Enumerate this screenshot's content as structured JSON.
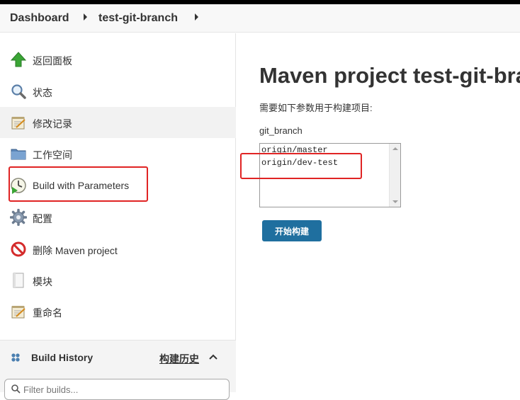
{
  "breadcrumb": {
    "items": [
      "Dashboard",
      "test-git-branch"
    ]
  },
  "sidebar": {
    "items": [
      {
        "label": "返回面板",
        "icon": "up-arrow-icon"
      },
      {
        "label": "状态",
        "icon": "magnifier-icon"
      },
      {
        "label": "修改记录",
        "icon": "notepad-icon"
      },
      {
        "label": "工作空间",
        "icon": "folder-icon"
      },
      {
        "label": "Build with Parameters",
        "icon": "clock-icon"
      },
      {
        "label": "配置",
        "icon": "gear-icon"
      },
      {
        "label": "删除 Maven project",
        "icon": "no-entry-icon"
      },
      {
        "label": "模块",
        "icon": "document-icon"
      },
      {
        "label": "重命名",
        "icon": "notepad-icon"
      }
    ]
  },
  "build_history": {
    "title": "Build History",
    "trend_link": "构建历史",
    "filter_placeholder": "Filter builds..."
  },
  "main": {
    "title": "Maven project test-git-branch",
    "description": "需要如下参数用于构建项目:",
    "parameter": {
      "name": "git_branch",
      "options": [
        "origin/master",
        "origin/dev-test"
      ]
    },
    "build_button": "开始构建"
  },
  "colors": {
    "accent": "#1f6f9f",
    "annotation": "#e02424"
  }
}
